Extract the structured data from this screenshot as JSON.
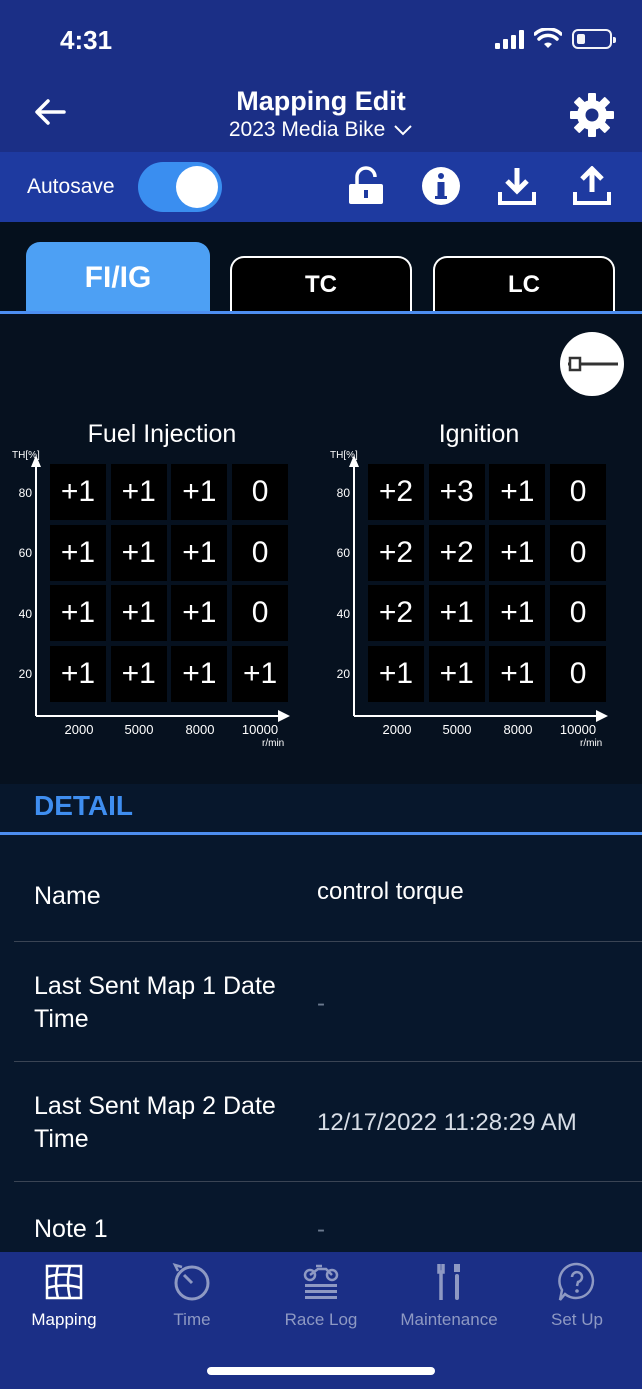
{
  "status": {
    "time": "4:31"
  },
  "header": {
    "title": "Mapping Edit",
    "subtitle": "2023 Media Bike"
  },
  "toolbar": {
    "autosave_label": "Autosave",
    "autosave_on": true
  },
  "tabs": [
    {
      "label": "FI/IG",
      "active": true
    },
    {
      "label": "TC",
      "active": false
    },
    {
      "label": "LC",
      "active": false
    }
  ],
  "maps": {
    "y_unit": "TH[%]",
    "x_unit": "r/min",
    "y_ticks": [
      "80",
      "60",
      "40",
      "20"
    ],
    "x_ticks": [
      "2000",
      "5000",
      "8000",
      "10000"
    ],
    "fuel": {
      "title": "Fuel Injection",
      "rows": [
        [
          "+1",
          "+1",
          "+1",
          "0"
        ],
        [
          "+1",
          "+1",
          "+1",
          "0"
        ],
        [
          "+1",
          "+1",
          "+1",
          "0"
        ],
        [
          "+1",
          "+1",
          "+1",
          "+1"
        ]
      ]
    },
    "ignition": {
      "title": "Ignition",
      "rows": [
        [
          "+2",
          "+3",
          "+1",
          "0"
        ],
        [
          "+2",
          "+2",
          "+1",
          "0"
        ],
        [
          "+2",
          "+1",
          "+1",
          "0"
        ],
        [
          "+1",
          "+1",
          "+1",
          "0"
        ]
      ]
    }
  },
  "detail": {
    "heading": "DETAIL",
    "rows": [
      {
        "label": "Name",
        "value": "control torque"
      },
      {
        "label": "Last Sent Map 1 Date Time",
        "value": "-"
      },
      {
        "label": "Last Sent Map 2 Date Time",
        "value": "12/17/2022 11:28:29 AM"
      },
      {
        "label": "Note 1",
        "value": "-"
      }
    ]
  },
  "nav": [
    {
      "label": "Mapping",
      "icon": "map-grid-icon",
      "active": true
    },
    {
      "label": "Time",
      "icon": "stopwatch-icon",
      "active": false
    },
    {
      "label": "Race Log",
      "icon": "motorcycle-icon",
      "active": false
    },
    {
      "label": "Maintenance",
      "icon": "tools-icon",
      "active": false
    },
    {
      "label": "Set Up",
      "icon": "help-bubble-icon",
      "active": false
    }
  ],
  "colors": {
    "header": "#1b2f86",
    "accent": "#4da0f4",
    "background": "#0b1a30"
  }
}
